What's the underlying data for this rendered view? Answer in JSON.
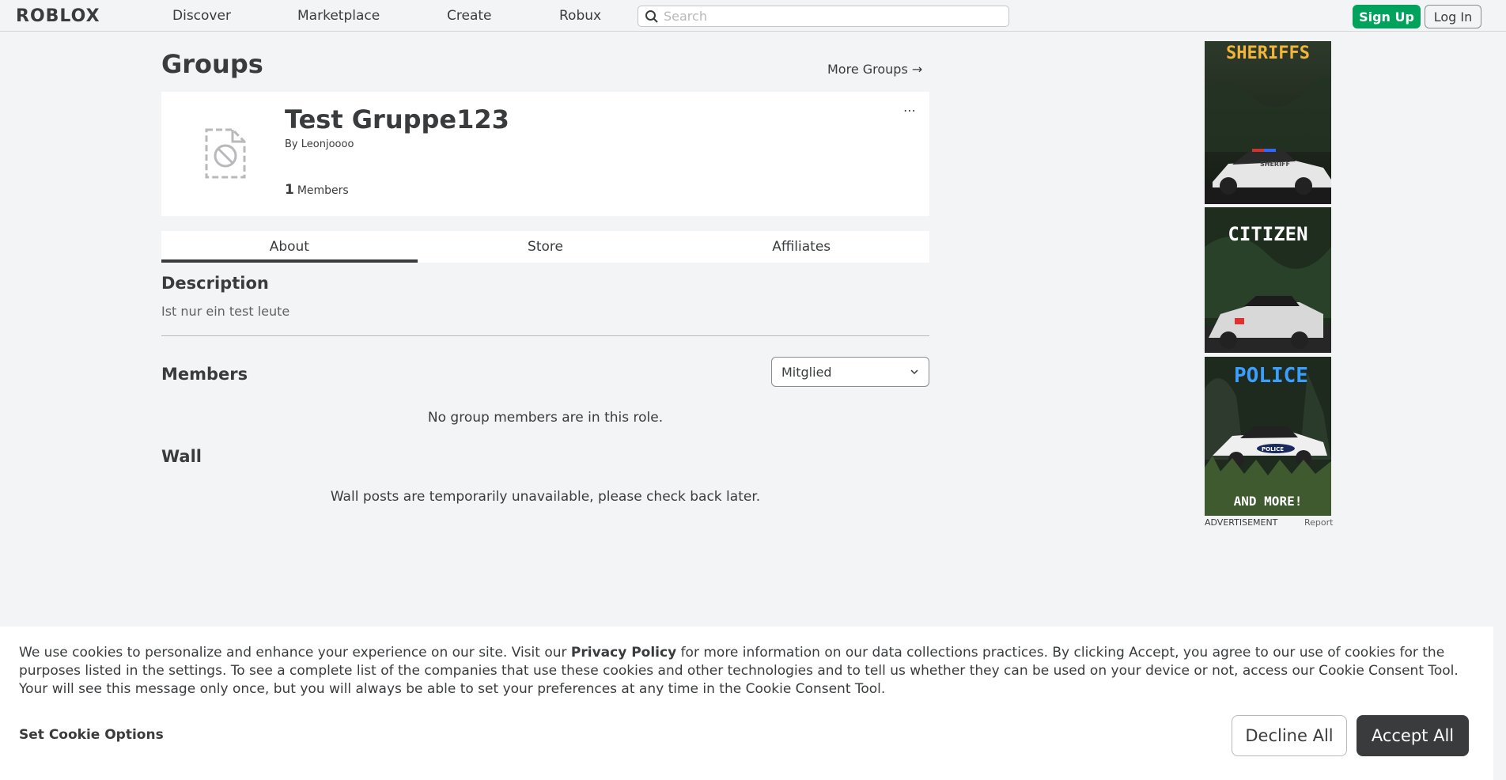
{
  "nav": {
    "logo": "ROBLOX",
    "links": [
      "Discover",
      "Marketplace",
      "Create",
      "Robux"
    ],
    "search_placeholder": "Search",
    "signup_label": "Sign Up",
    "login_label": "Log In"
  },
  "page": {
    "title": "Groups",
    "more_groups": "More Groups →"
  },
  "group": {
    "name": "Test Gruppe123",
    "by_prefix": "By",
    "owner": "Leonjoooo",
    "member_count": "1",
    "members_label": "Members",
    "more_menu": "⋯"
  },
  "tabs": [
    "About",
    "Store",
    "Affiliates"
  ],
  "about": {
    "description_heading": "Description",
    "description_text": "Ist nur ein test leute",
    "members_heading": "Members",
    "role_selected": "Mitglied",
    "no_members_msg": "No group members are in this role.",
    "wall_heading": "Wall",
    "wall_msg": "Wall posts are temporarily unavailable, please check back later."
  },
  "ad": {
    "panels": [
      "SHERIFFS",
      "CITIZEN",
      "POLICE"
    ],
    "footer_tagline": "AND MORE!",
    "car_label": "SHERIFF",
    "car_label_2": "POLICE",
    "label": "ADVERTISEMENT",
    "report": "Report"
  },
  "cookie": {
    "text_before": "We use cookies to personalize and enhance your experience on our site. Visit our ",
    "privacy_link": "Privacy Policy",
    "text_after": " for more information on our data collections practices. By clicking Accept, you agree to our use of cookies for the purposes listed in the settings. To see a complete list of the companies that use these cookies and other technologies and to tell us whether they can be used on your device or not, access our Cookie Consent Tool. Your will see this message only once, but you will always be able to set your preferences at any time in the Cookie Consent Tool.",
    "options_label": "Set Cookie Options",
    "decline_label": "Decline All",
    "accept_label": "Accept All"
  }
}
